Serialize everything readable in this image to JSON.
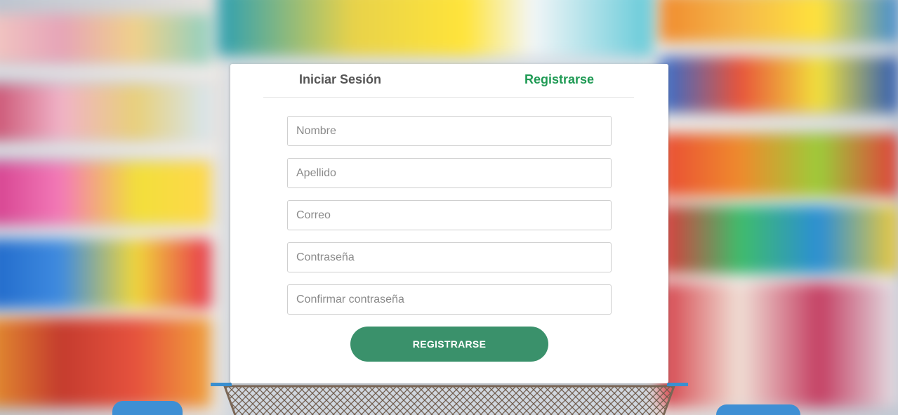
{
  "tabs": {
    "login_label": "Iniciar Sesión",
    "register_label": "Registrarse",
    "active": "register"
  },
  "form": {
    "fields": [
      {
        "name": "nombre",
        "placeholder": "Nombre",
        "value": ""
      },
      {
        "name": "apellido",
        "placeholder": "Apellido",
        "value": ""
      },
      {
        "name": "correo",
        "placeholder": "Correo",
        "value": ""
      },
      {
        "name": "contrasena",
        "placeholder": "Contraseña",
        "value": ""
      },
      {
        "name": "confirmar",
        "placeholder": "Confirmar contraseña",
        "value": ""
      }
    ],
    "submit_label": "REGISTRARSE"
  },
  "colors": {
    "accent": "#1f9a54",
    "button": "#3a916b",
    "inactive_tab": "#555555"
  }
}
